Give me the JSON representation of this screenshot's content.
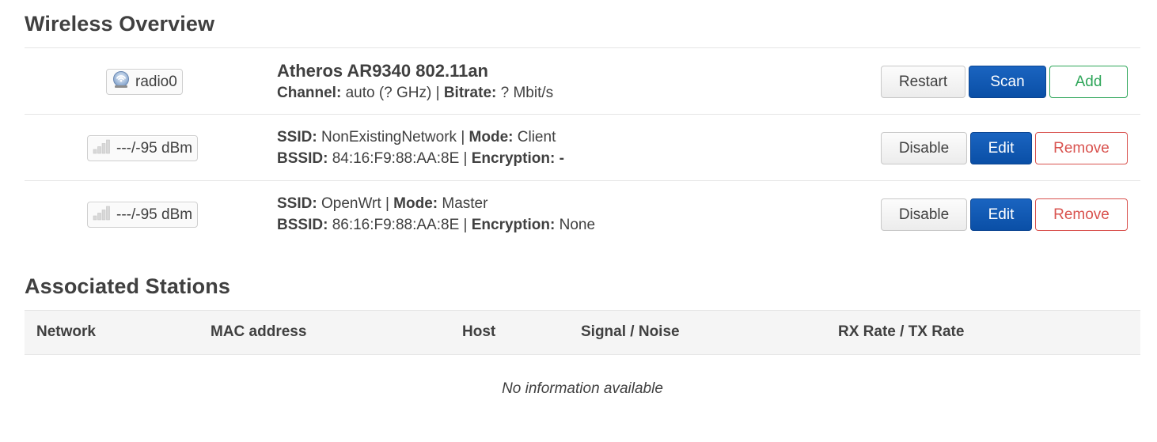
{
  "overview": {
    "title": "Wireless Overview",
    "radio": {
      "badge": "radio0",
      "icon": "wifi-radio-icon",
      "name": "Atheros AR9340 802.11an",
      "channel_label": "Channel:",
      "channel_value": "auto (? GHz)",
      "bitrate_label": "Bitrate:",
      "bitrate_value": "? Mbit/s",
      "buttons": {
        "restart": "Restart",
        "scan": "Scan",
        "add": "Add"
      }
    },
    "networks": [
      {
        "signal_icon": "signal-bars-icon",
        "signal": "---/-95 dBm",
        "ssid_label": "SSID:",
        "ssid": "NonExistingNetwork",
        "mode_label": "Mode:",
        "mode": "Client",
        "bssid_label": "BSSID:",
        "bssid": "84:16:F9:88:AA:8E",
        "enc_label": "Encryption:",
        "enc": "-",
        "buttons": {
          "disable": "Disable",
          "edit": "Edit",
          "remove": "Remove"
        }
      },
      {
        "signal_icon": "signal-bars-icon",
        "signal": "---/-95 dBm",
        "ssid_label": "SSID:",
        "ssid": "OpenWrt",
        "mode_label": "Mode:",
        "mode": "Master",
        "bssid_label": "BSSID:",
        "bssid": "86:16:F9:88:AA:8E",
        "enc_label": "Encryption:",
        "enc": "None",
        "buttons": {
          "disable": "Disable",
          "edit": "Edit",
          "remove": "Remove"
        }
      }
    ],
    "separator": "|"
  },
  "stations": {
    "title": "Associated Stations",
    "columns": [
      "Network",
      "MAC address",
      "Host",
      "Signal / Noise",
      "RX Rate / TX Rate"
    ],
    "empty_text": "No information available"
  },
  "colors": {
    "primary": "#0a4fa6",
    "positive": "#2fa65a",
    "negative": "#d9534f",
    "text": "#404040",
    "header_bg": "#f5f5f5"
  }
}
